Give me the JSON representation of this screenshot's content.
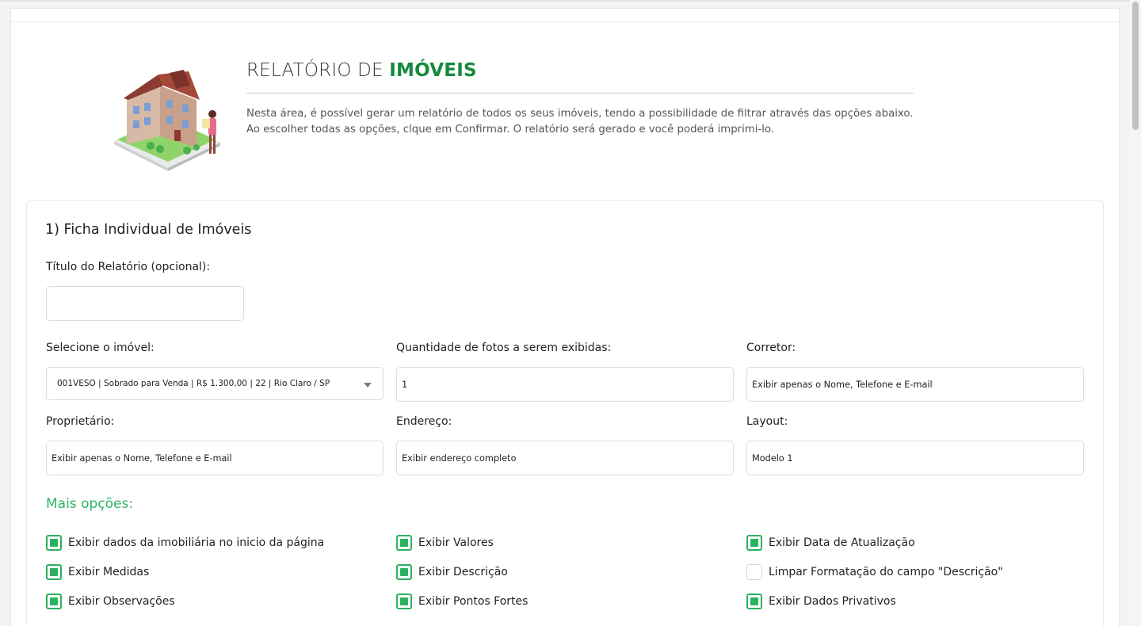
{
  "header": {
    "title_prefix": "RELATÓRIO DE ",
    "title_highlight": "IMÓVEIS",
    "description": "Nesta área, é possível gerar um relatório de todos os seus imóveis, tendo a possibilidade de filtrar através das opções abaixo. Ao escolher todas as opções, clque em Confirmar. O relatório será gerado e você poderá imprimi-lo."
  },
  "section": {
    "title": "1) Ficha Individual de Imóveis",
    "report_title_label": "Título do Relatório (opcional):",
    "report_title_value": "",
    "fields": {
      "property_label": "Selecione o imóvel:",
      "property_value": "001VESO | Sobrado para Venda | R$ 1.300,00 | 22 | Rio Claro / SP",
      "photos_label": "Quantidade de fotos a serem exibidas:",
      "photos_value": "1",
      "broker_label": "Corretor:",
      "broker_value": "Exibir apenas o Nome, Telefone e E-mail",
      "owner_label": "Proprietário:",
      "owner_value": "Exibir apenas o Nome, Telefone e E-mail",
      "address_label": "Endereço:",
      "address_value": "Exibir endereço completo",
      "layout_label": "Layout:",
      "layout_value": "Modelo 1"
    },
    "more_options_title": "Mais opções:",
    "options": [
      {
        "label": "Exibir dados da imobiliária no inicio da página",
        "checked": true
      },
      {
        "label": "Exibir Valores",
        "checked": true
      },
      {
        "label": "Exibir Data de Atualização",
        "checked": true
      },
      {
        "label": "Exibir Medidas",
        "checked": true
      },
      {
        "label": "Exibir Descrição",
        "checked": true
      },
      {
        "label": "Limpar Formatação do campo \"Descrição\"",
        "checked": false
      },
      {
        "label": "Exibir Observações",
        "checked": true
      },
      {
        "label": "Exibir Pontos Fortes",
        "checked": true
      },
      {
        "label": "Exibir Dados Privativos",
        "checked": true
      }
    ]
  },
  "colors": {
    "accent": "#148a3d",
    "checkbox": "#2ab25f"
  }
}
